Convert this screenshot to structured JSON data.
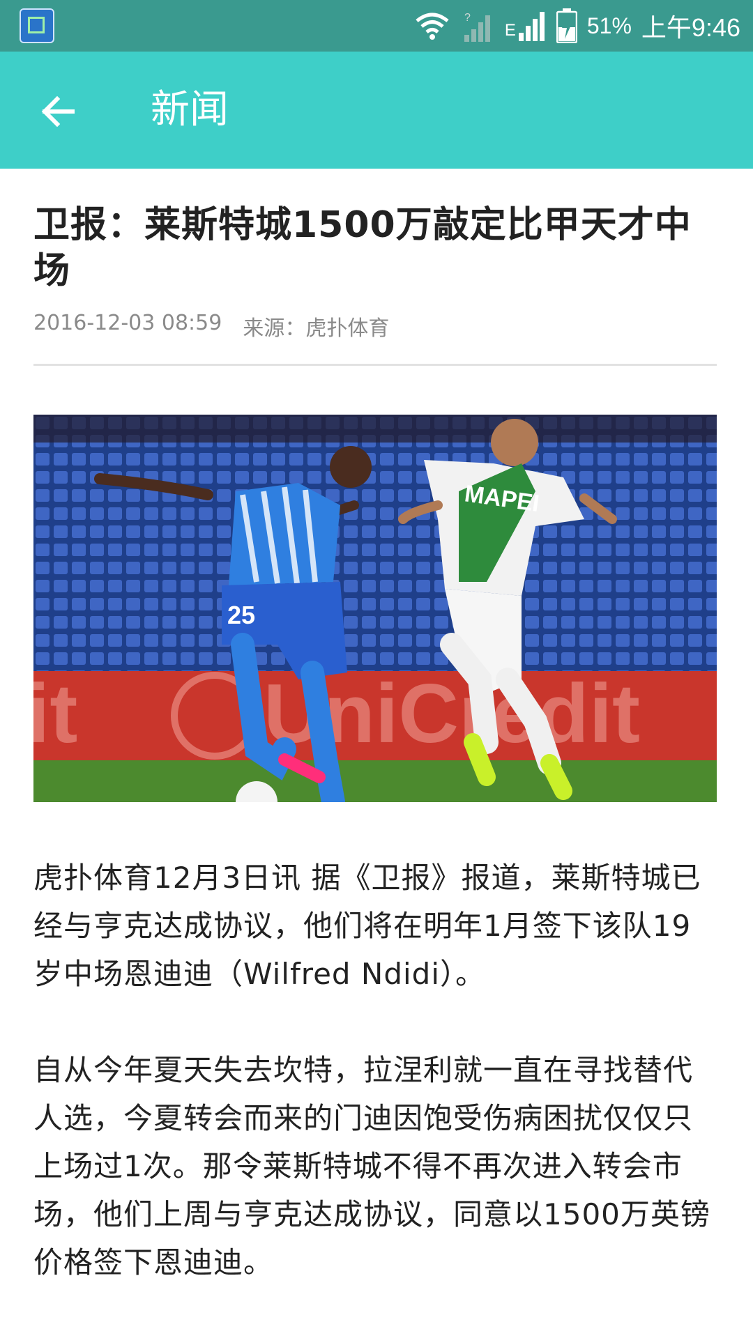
{
  "status_bar": {
    "battery_percent": "51%",
    "time": "上午9:46",
    "network_label": "E",
    "icons": [
      "app-screenshot-icon",
      "wifi-icon",
      "signal-icon",
      "signal-icon",
      "battery-charging-icon"
    ]
  },
  "toolbar": {
    "title": "新闻",
    "back_icon": "arrow-left-icon"
  },
  "article": {
    "headline": "卫报：莱斯特城1500万敲定比甲天才中场",
    "date": "2016-12-03 08:59",
    "source": "来源：虎扑体育",
    "image": "football-match-photo",
    "paragraphs": [
      "虎扑体育12月3日讯 据《卫报》报道，莱斯特城已经与亨克达成协议，他们将在明年1月签下该队19岁中场恩迪迪（Wilfred Ndidi）。",
      "自从今年夏天失去坎特，拉涅利就一直在寻找替代人选，今夏转会而来的门迪因饱受伤病困扰仅仅只上场过1次。那令莱斯特城不得不再次进入转会市场，他们上周与亨克达成协议，同意以1500万英镑价格签下恩迪迪。"
    ]
  },
  "colors": {
    "status_bar": "#3a9a8f",
    "toolbar": "#3ecfc8",
    "text": "#222222",
    "meta": "#8a8a8a"
  }
}
